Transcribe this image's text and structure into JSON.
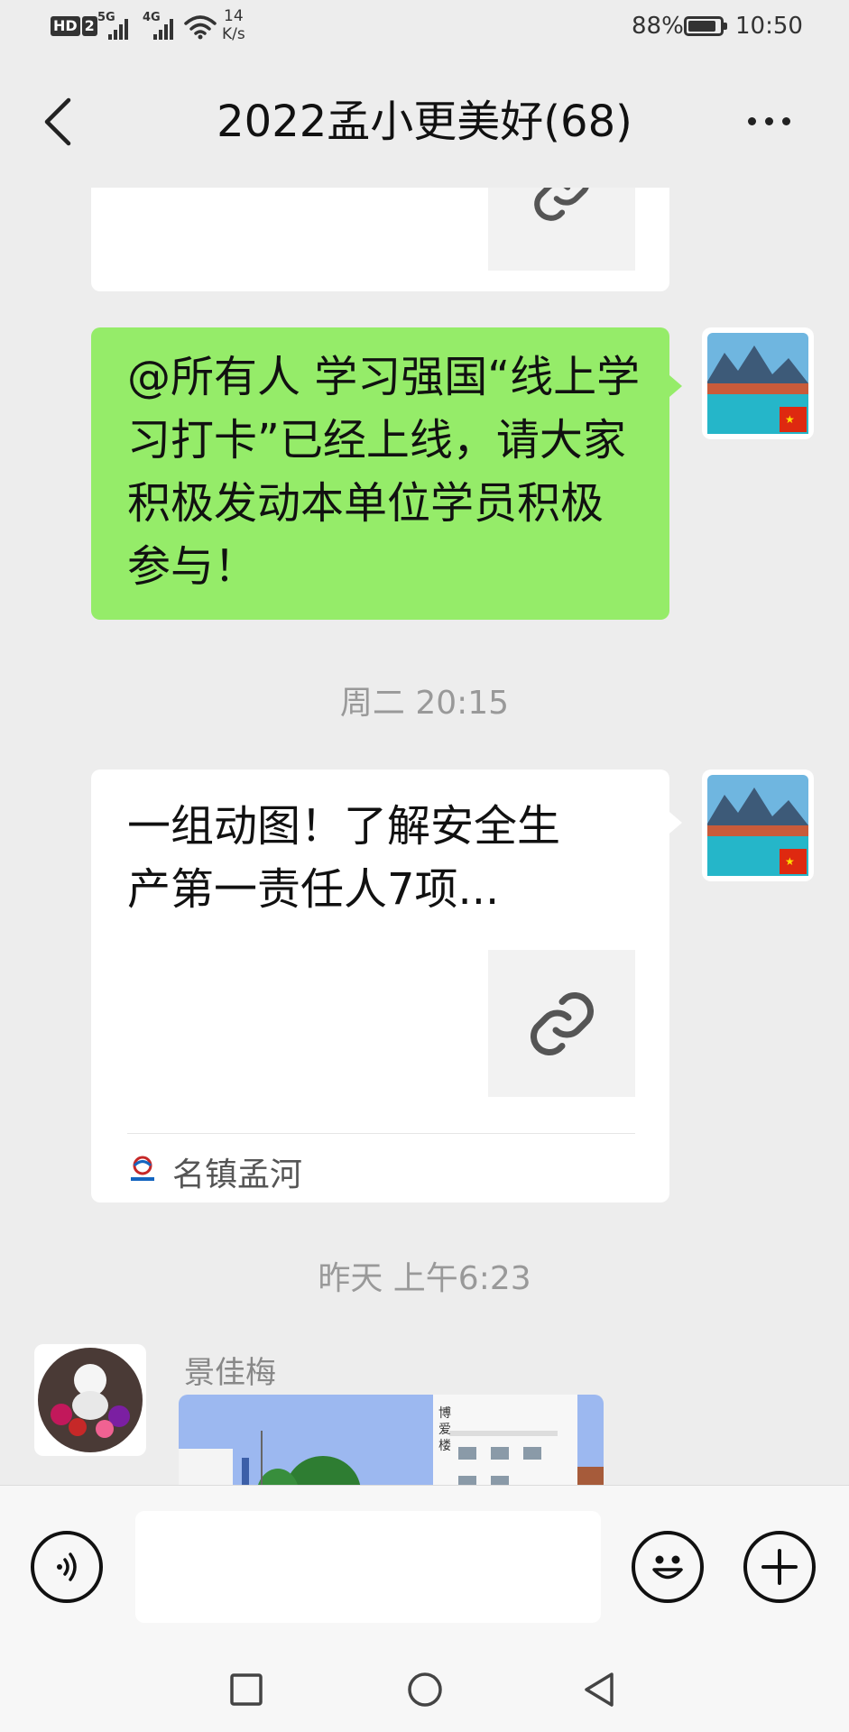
{
  "status_bar": {
    "hd_label": "HD",
    "sim_label": "2",
    "net1": "5G",
    "net2": "4G",
    "speed_value": "14",
    "speed_unit": "K/s",
    "battery": "88%",
    "battery_level": 0.88,
    "time": "10:50"
  },
  "nav": {
    "title": "2022孟小更美好(68)"
  },
  "messages": [
    {
      "type": "text",
      "side": "right",
      "text": "@所有人  学习强国“线上学习打卡”已经上线，请大家积极发动本单位学员积极参与！"
    },
    {
      "type": "time",
      "text": "周二 20:15"
    },
    {
      "type": "link",
      "side": "right",
      "title": "一组动图！了解安全生产第一责任人7项...",
      "source": "名镇孟河"
    },
    {
      "type": "time",
      "text": "昨天 上午6:23"
    },
    {
      "type": "image",
      "side": "left",
      "sender": "景佳梅",
      "building_sign": "博爱楼"
    }
  ],
  "colors": {
    "bg": "#ededed",
    "green_bubble": "#95ec69",
    "white_bubble": "#ffffff"
  },
  "icons": {
    "back": "chevron-left-icon",
    "more": "more-dots-icon",
    "link": "link-icon",
    "voice": "voice-icon",
    "emoji": "emoji-icon",
    "plus": "plus-icon"
  }
}
